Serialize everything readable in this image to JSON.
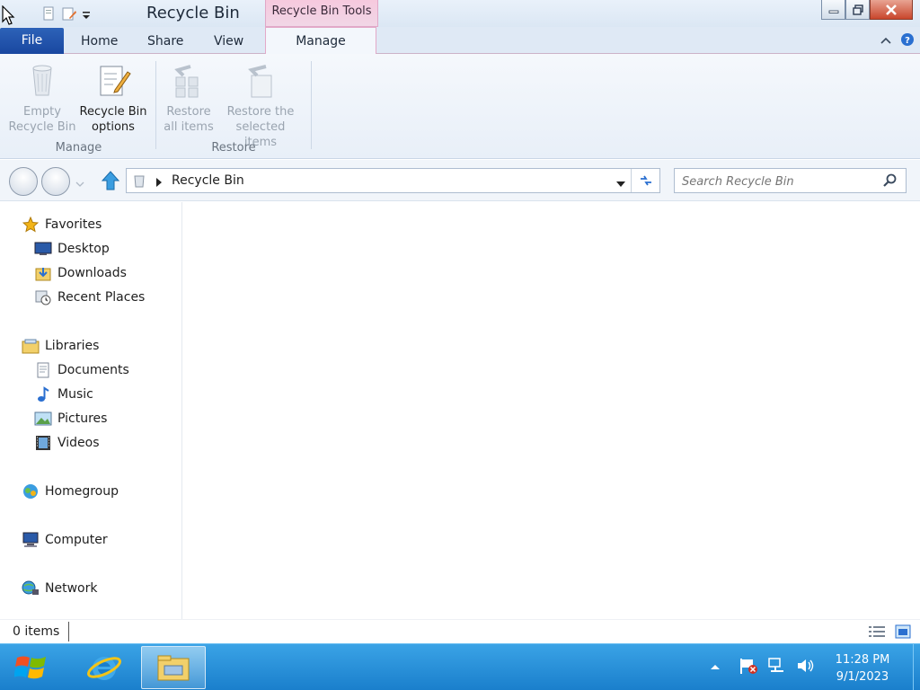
{
  "window": {
    "title": "Recycle Bin",
    "context_tab_group": "Recycle Bin Tools"
  },
  "ribbon": {
    "tabs": {
      "file": "File",
      "home": "Home",
      "share": "Share",
      "view": "View",
      "manage": "Manage"
    },
    "manage_group": {
      "label": "Manage",
      "empty_line1": "Empty",
      "empty_line2": "Recycle Bin",
      "options_line1": "Recycle Bin",
      "options_line2": "options"
    },
    "restore_group": {
      "label": "Restore",
      "restore_all_line1": "Restore",
      "restore_all_line2": "all items",
      "restore_selected_line1": "Restore the",
      "restore_selected_line2": "selected items"
    }
  },
  "address": {
    "path": "Recycle Bin",
    "search_placeholder": "Search Recycle Bin"
  },
  "nav": {
    "favorites": "Favorites",
    "desktop": "Desktop",
    "downloads": "Downloads",
    "recent_places": "Recent Places",
    "libraries": "Libraries",
    "documents": "Documents",
    "music": "Music",
    "pictures": "Pictures",
    "videos": "Videos",
    "homegroup": "Homegroup",
    "computer": "Computer",
    "network": "Network"
  },
  "status": {
    "item_count": "0 items"
  },
  "taskbar": {
    "time": "11:28 PM",
    "date": "9/1/2023"
  },
  "colors": {
    "file_tab": "#1947a0",
    "context_tab": "#f1d6e6",
    "taskbar": "#1a7fcc",
    "close_button": "#c9462c"
  }
}
